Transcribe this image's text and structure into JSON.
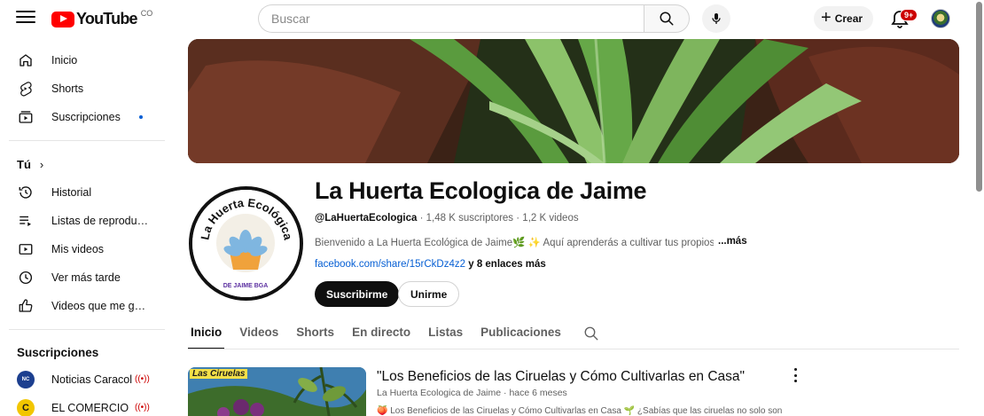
{
  "header": {
    "logo_text": "YouTube",
    "logo_country": "CO",
    "search_placeholder": "Buscar",
    "create_label": "Crear",
    "notifications_badge": "9+"
  },
  "sidebar": {
    "main": [
      {
        "label": "Inicio",
        "icon": "home-icon"
      },
      {
        "label": "Shorts",
        "icon": "shorts-icon"
      },
      {
        "label": "Suscripciones",
        "icon": "subscriptions-icon"
      }
    ],
    "you_label": "Tú",
    "you_items": [
      {
        "label": "Historial",
        "icon": "history-icon"
      },
      {
        "label": "Listas de reproducción",
        "icon": "playlists-icon"
      },
      {
        "label": "Mis videos",
        "icon": "my-videos-icon"
      },
      {
        "label": "Ver más tarde",
        "icon": "watch-later-icon"
      },
      {
        "label": "Videos que me gustan",
        "icon": "liked-videos-icon"
      }
    ],
    "subscriptions_label": "Suscripciones",
    "subscriptions": [
      {
        "label": "Noticias Caracol",
        "avatar_color": "#1c3f8f"
      },
      {
        "label": "EL COMERCIO",
        "avatar_color": "#f2c600"
      }
    ]
  },
  "channel": {
    "name": "La Huerta Ecologica de Jaime",
    "handle": "@LaHuertaEcologica",
    "subscribers": "1,48 K suscriptores",
    "videos": "1,2 K videos",
    "description": "Bienvenido a La Huerta Ecológica de Jaime🌿 ✨ Aquí aprenderás a cultivar tus propios",
    "more_label": "...más",
    "link": "facebook.com/share/15rCkDz4z2",
    "more_links": "y 8 enlaces más",
    "subscribe_label": "Suscribirme",
    "join_label": "Unirme",
    "avatar_ring_text": "La Huerta Ecológica",
    "avatar_bottom_text": "DE JAIME BGA"
  },
  "tabs": [
    "Inicio",
    "Videos",
    "Shorts",
    "En directo",
    "Listas",
    "Publicaciones"
  ],
  "featured": {
    "thumb_label": "Las Ciruelas",
    "title": "\"Los Beneficios de las Ciruelas y Cómo Cultivarlas en Casa\"",
    "channel": "La Huerta Ecologica de Jaime",
    "age": "hace 6 meses",
    "description": "🍑 Los Beneficios de las Ciruelas y Cómo Cultivarlas en Casa 🌱 ¿Sabías que las ciruelas no solo son"
  },
  "colors": {
    "brand_red": "#ff0000",
    "link_blue": "#065fd4",
    "subscribe_bg": "#0f0f0f"
  }
}
